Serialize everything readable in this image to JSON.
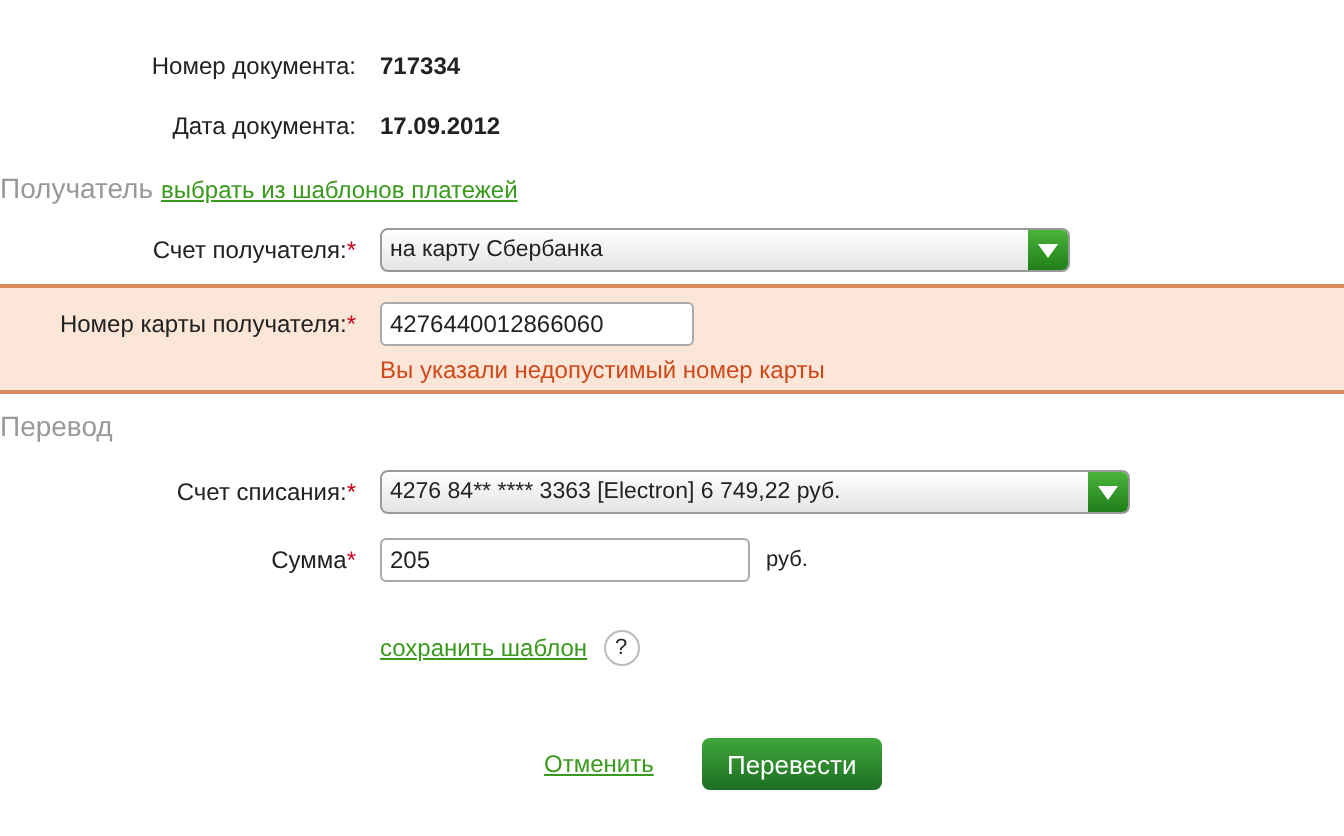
{
  "document": [
    {
      "label": "Номер документа:",
      "value": "717334"
    },
    {
      "label": "Дата документа:",
      "value": "17.09.2012"
    }
  ],
  "recipient": {
    "title": "Получатель",
    "template_link": "выбрать из шаблонов платежей",
    "fields": [
      {
        "kind": "select",
        "label": "Счет получателя:",
        "required_mark": "*",
        "value": "на карту Сбербанка",
        "error": false
      },
      {
        "kind": "input",
        "label": "Номер карты получателя:",
        "required_mark": "*",
        "value": "4276440012866060",
        "error": true,
        "error_text": "Вы указали недопустимый номер карты"
      }
    ]
  },
  "transfer": {
    "title": "Перевод",
    "fields": [
      {
        "kind": "select",
        "label": "Счет списания:",
        "required_mark": "*",
        "value": "4276 84** **** 3363  [Electron] 6 749,22  руб.",
        "error": false
      },
      {
        "kind": "amount",
        "label": "Сумма",
        "required_mark": "*",
        "value": "205",
        "unit": "руб.",
        "error": false
      }
    ]
  },
  "save_template_link": "сохранить шаблон",
  "help": "?",
  "buttons": {
    "cancel": "Отменить",
    "submit": "Перевести"
  }
}
